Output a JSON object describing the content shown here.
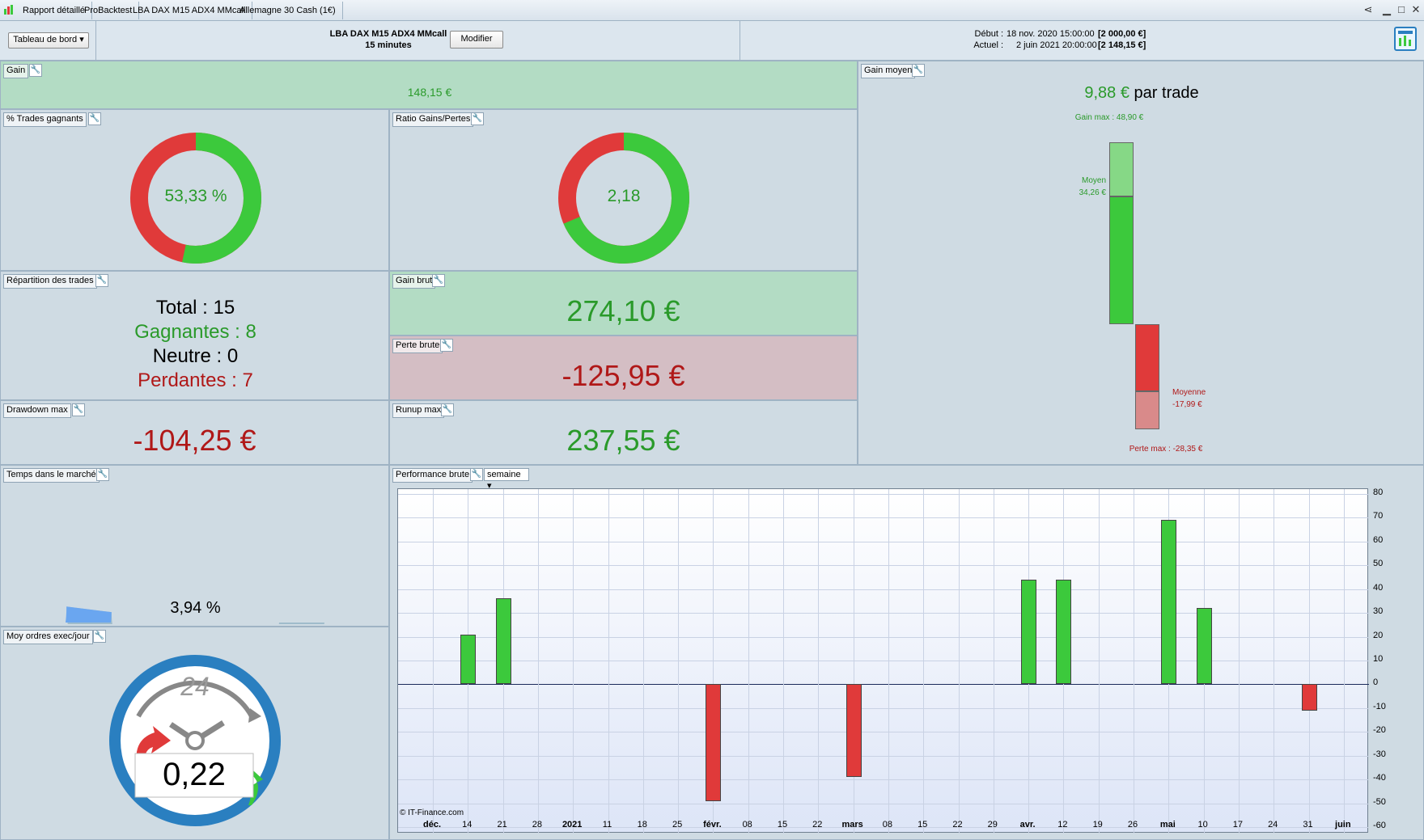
{
  "tabs": [
    {
      "label": "Rapport détaillé"
    },
    {
      "label": "ProBacktest"
    },
    {
      "label": "LBA DAX M15 ADX4 MMcall"
    },
    {
      "label": "Allemagne 30 Cash (1€)"
    }
  ],
  "header": {
    "dashboard_select": "Tableau de bord",
    "strategy_name": "LBA DAX M15 ADX4 MMcall",
    "timeframe": "15 minutes",
    "modify_button": "Modifier",
    "start_label": "Début :",
    "start_value": "18 nov. 2020 15:00:00",
    "start_capital": "[2 000,00 €]",
    "current_label": "Actuel :",
    "current_value": "2 juin 2021 20:00:00",
    "current_capital": "[2 148,15 €]"
  },
  "gain": {
    "label": "Gain",
    "value": "148,15 €"
  },
  "win_trades": {
    "label": "% Trades gagnants",
    "value": "53,33 %",
    "fraction": 0.5333
  },
  "ratio": {
    "label": "Ratio Gains/Pertes",
    "value": "2,18",
    "fraction": 0.6855
  },
  "distribution": {
    "label": "Répartition des trades",
    "total_label": "Total :",
    "total": "15",
    "winners_label": "Gagnantes :",
    "winners": "8",
    "neutral_label": "Neutre :",
    "neutral": "0",
    "losers_label": "Perdantes :",
    "losers": "7"
  },
  "gross_gain": {
    "label": "Gain brut",
    "value": "274,10 €"
  },
  "gross_loss": {
    "label": "Perte brute",
    "value": "-125,95 €"
  },
  "drawdown": {
    "label": "Drawdown max",
    "value": "-104,25 €"
  },
  "runup": {
    "label": "Runup max",
    "value": "237,55 €"
  },
  "avg_gain": {
    "label": "Gain moyen",
    "value": "9,88 €",
    "per_trade": "par trade",
    "gain_max_label": "Gain max : 48,90 €",
    "avg_win_label": "Moyen",
    "avg_win_value": "34,26 €",
    "avg_loss_label": "Moyenne",
    "avg_loss_value": "-17,99 €",
    "loss_max_label": "Perte max : -28,35 €",
    "gain_max": 48.9,
    "avg_win": 34.26,
    "avg_loss": -17.99,
    "loss_max": -28.35
  },
  "time_in_market": {
    "label": "Temps dans le marché",
    "value": "3,94 %",
    "fraction": 0.0394
  },
  "orders_per_day": {
    "label": "Moy ordres exec/jour",
    "value": "0,22",
    "clock_hours": "24"
  },
  "performance": {
    "label": "Performance brute",
    "period": "semaine",
    "copyright": "© IT-Finance.com"
  },
  "colors": {
    "green": "#3cc93c",
    "red": "#e03a3a",
    "gain_panel": "#b3dcc4",
    "loss_panel": "#d4bec4"
  },
  "chart_data": {
    "type": "bar",
    "title": "",
    "ylim": [
      -60,
      80
    ],
    "yticks": [
      80,
      70,
      60,
      50,
      40,
      30,
      20,
      10,
      0,
      -10,
      -20,
      -30,
      -40,
      -50,
      -60
    ],
    "xticks": [
      {
        "label": "déc.",
        "bold": true
      },
      {
        "label": "14"
      },
      {
        "label": "21"
      },
      {
        "label": "28"
      },
      {
        "label": "2021",
        "bold": true
      },
      {
        "label": "11"
      },
      {
        "label": "18"
      },
      {
        "label": "25"
      },
      {
        "label": "févr.",
        "bold": true
      },
      {
        "label": "08"
      },
      {
        "label": "15"
      },
      {
        "label": "22"
      },
      {
        "label": "mars",
        "bold": true
      },
      {
        "label": "08"
      },
      {
        "label": "15"
      },
      {
        "label": "22"
      },
      {
        "label": "29"
      },
      {
        "label": "avr.",
        "bold": true
      },
      {
        "label": "12"
      },
      {
        "label": "19"
      },
      {
        "label": "26"
      },
      {
        "label": "mai",
        "bold": true
      },
      {
        "label": "10"
      },
      {
        "label": "17"
      },
      {
        "label": "24"
      },
      {
        "label": "31"
      },
      {
        "label": "juin",
        "bold": true
      }
    ],
    "bars": [
      {
        "x": "14",
        "value": 21
      },
      {
        "x": "21",
        "value": 36
      },
      {
        "x": "févr.",
        "value": -49
      },
      {
        "x": "mars",
        "value": -39
      },
      {
        "x": "avr.",
        "value": 44
      },
      {
        "x": "12",
        "value": 44
      },
      {
        "x": "mai",
        "value": 69
      },
      {
        "x": "10",
        "value": 32
      },
      {
        "x": "31",
        "value": -11
      }
    ]
  }
}
